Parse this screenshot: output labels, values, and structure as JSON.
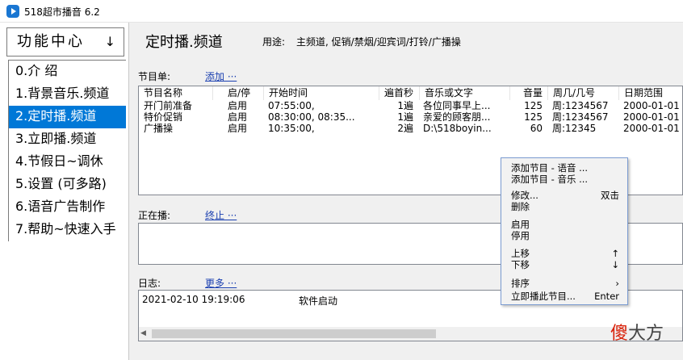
{
  "window": {
    "title": "518超市播音  6.2"
  },
  "sidebar": {
    "header": "功能中心",
    "header_arrow": "↓",
    "items": [
      {
        "label": "0.介  绍"
      },
      {
        "label": "1.背景音乐.频道"
      },
      {
        "label": "2.定时播.频道"
      },
      {
        "label": "3.立即播.频道"
      },
      {
        "label": "4.节假日~调休"
      },
      {
        "label": "5.设置 (可多路)"
      },
      {
        "label": "6.语音广告制作"
      },
      {
        "label": "7.帮助~快速入手"
      }
    ]
  },
  "main": {
    "title": "定时播.频道",
    "usage_label": "用途:",
    "usage_text": "主频道, 促销/禁烟/迎宾词/打铃/广播操",
    "program_list_label": "节目单:",
    "add_link": "添加 ···",
    "columns": [
      "节目名称",
      "启/停",
      "开始时间",
      "遍首秒",
      "音乐或文字",
      "音量",
      "周几/几号",
      "日期范围"
    ],
    "rows": [
      {
        "name": "开门前准备",
        "status": "启用",
        "start": "07:55:00,",
        "repeat": "1遍",
        "content": "各位同事早上...",
        "volume": "125",
        "days": "周:1234567",
        "date": "2000-01-01"
      },
      {
        "name": "特价促销",
        "status": "启用",
        "start": "08:30:00, 08:35...",
        "repeat": "1遍",
        "content": "亲爱的顾客朋...",
        "volume": "125",
        "days": "周:1234567",
        "date": "2000-01-01"
      },
      {
        "name": "广播操",
        "status": "启用",
        "start": "10:35:00,",
        "repeat": "2遍",
        "content": "D:\\518boyin...",
        "volume": "60",
        "days": "周:12345",
        "date": "2000-01-01"
      }
    ],
    "now_playing_label": "正在播:",
    "stop_link": "终止 ···",
    "log_label": "日志:",
    "more_link": "更多 ···",
    "log_entries": [
      {
        "time": "2021-02-10 19:19:06",
        "message": "软件启动"
      }
    ]
  },
  "context_menu": {
    "add_voice": "添加节目 - 语音 ...",
    "add_music": "添加节目 - 音乐 ...",
    "modify": "修改...",
    "modify_key": "双击",
    "delete": "删除",
    "enable": "启用",
    "disable": "停用",
    "move_up": "上移",
    "move_up_key": "↑",
    "move_down": "下移",
    "move_down_key": "↓",
    "sort": "排序",
    "sort_key": "›",
    "play_now": "立即播此节目...",
    "play_now_key": "Enter"
  },
  "watermark": {
    "first": "傻",
    "rest": "大方"
  },
  "colors": {
    "selection": "#0078d7",
    "link": "#1a3fb0",
    "watermark_red": "#d81e06"
  }
}
